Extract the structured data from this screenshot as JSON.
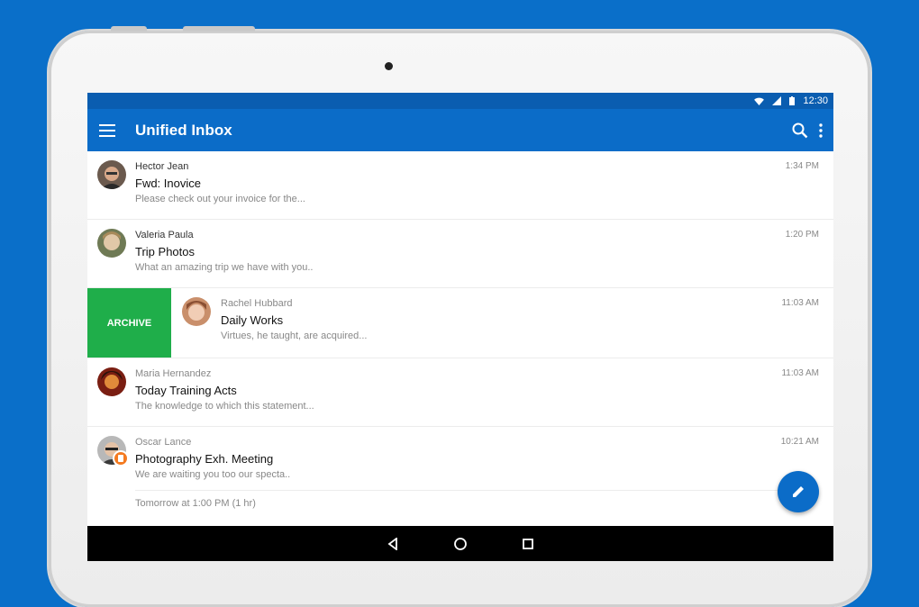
{
  "status": {
    "time": "12:30"
  },
  "appbar": {
    "title": "Unified Inbox"
  },
  "archive_label": "ARCHIVE",
  "messages": [
    {
      "sender": "Hector Jean",
      "subject": "Fwd: Inovice",
      "preview": "Please check out your invoice for the...",
      "time": "1:34 PM"
    },
    {
      "sender": "Valeria Paula",
      "subject": "Trip Photos",
      "preview": "What an amazing trip we have with you..",
      "time": "1:20 PM"
    },
    {
      "sender": "Rachel Hubbard",
      "subject": "Daily Works",
      "preview": "Virtues, he taught, are acquired...",
      "time": "11:03 AM"
    },
    {
      "sender": "Maria Hernandez",
      "subject": "Today Training Acts",
      "preview": "The knowledge to which this statement...",
      "time": "11:03 AM"
    },
    {
      "sender": "Oscar Lance",
      "subject": "Photography Exh. Meeting",
      "preview": "We are waiting you too our specta..",
      "time": "10:21 AM",
      "event": "Tomorrow at 1:00 PM (1 hr)"
    }
  ],
  "colors": {
    "background": "#0a6fc9",
    "appbar": "#0b6cc8",
    "statusbar": "#0a5db0",
    "archive": "#1fae4a",
    "badge": "#f47a20"
  }
}
